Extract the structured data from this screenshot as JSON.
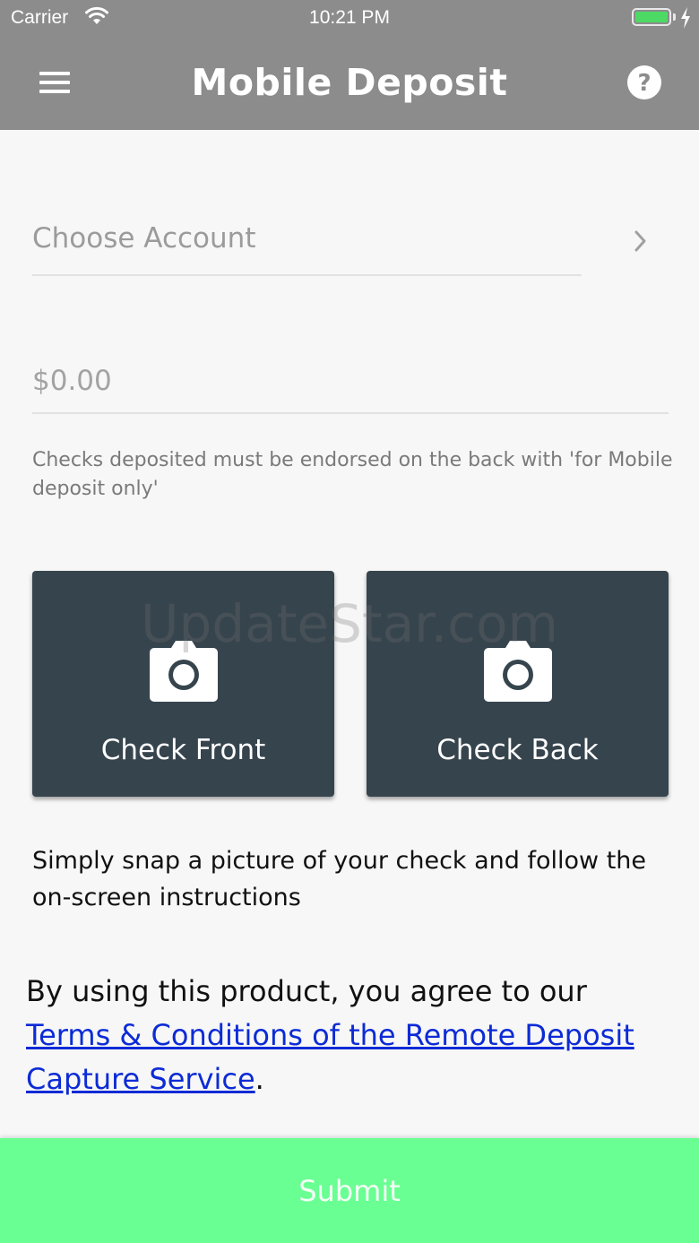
{
  "status_bar": {
    "carrier": "Carrier",
    "time": "10:21 PM",
    "battery_color": "#4cd964"
  },
  "nav": {
    "title": "Mobile Deposit",
    "menu_icon": "hamburger-menu-icon",
    "help_icon": "question-circle-icon",
    "background": "#8c8c8c"
  },
  "account": {
    "placeholder": "Choose Account",
    "chevron_icon": "chevron-right-icon"
  },
  "amount": {
    "placeholder": "$0.00"
  },
  "endorsement_note": "Checks deposited must be endorsed on the back with 'for Mobile deposit only'",
  "capture": {
    "front_label": "Check Front",
    "back_label": "Check Back",
    "icon": "camera-icon",
    "tile_color": "#36444d"
  },
  "watermark": "UpdateStar.com",
  "instructions": "Simply snap a picture of your check and follow the on-screen instructions",
  "terms": {
    "prefix": "By using this product, you agree to our ",
    "link_text": "Terms & Conditions of the Remote Deposit Capture Service",
    "suffix": "."
  },
  "submit": {
    "label": "Submit",
    "color": "#69ff92"
  }
}
